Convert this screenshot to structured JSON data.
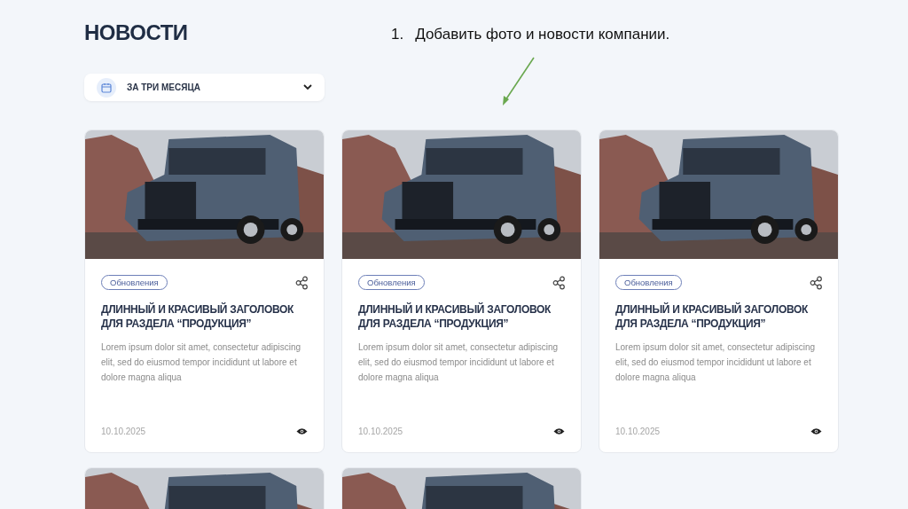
{
  "heading": "НОВОСТИ",
  "filter": {
    "label": "ЗА ТРИ МЕСЯЦА"
  },
  "annotation": {
    "number": "1.",
    "text": "Добавить фото и новости компании."
  },
  "cards": [
    {
      "kind": "full",
      "tag": "Обновления",
      "title": "ДЛИННЫЙ И КРАСИВЫЙ ЗАГОЛОВОК ДЛЯ РАЗДЕЛА “ПРОДУКЦИЯ”",
      "excerpt": "Lorem ipsum dolor sit amet, consectetur adipiscing elit, sed do eiusmod tempor incididunt ut labore et dolore magna aliqua",
      "date": "10.10.2025"
    },
    {
      "kind": "full",
      "tag": "Обновления",
      "title": "ДЛИННЫЙ И КРАСИВЫЙ ЗАГОЛОВОК ДЛЯ РАЗДЕЛА “ПРОДУКЦИЯ”",
      "excerpt": "Lorem ipsum dolor sit amet, consectetur adipiscing elit, sed do eiusmod tempor incididunt ut labore et dolore magna aliqua",
      "date": "10.10.2025"
    },
    {
      "kind": "full",
      "tag": "Обновления",
      "title": "ДЛИННЫЙ И КРАСИВЫЙ ЗАГОЛОВОК ДЛЯ РАЗДЕЛА “ПРОДУКЦИЯ”",
      "excerpt": "Lorem ipsum dolor sit amet, consectetur adipiscing elit, sed do eiusmod tempor incididunt ut labore et dolore magna aliqua",
      "date": "10.10.2025"
    },
    {
      "kind": "image_only"
    },
    {
      "kind": "image_only"
    }
  ]
}
